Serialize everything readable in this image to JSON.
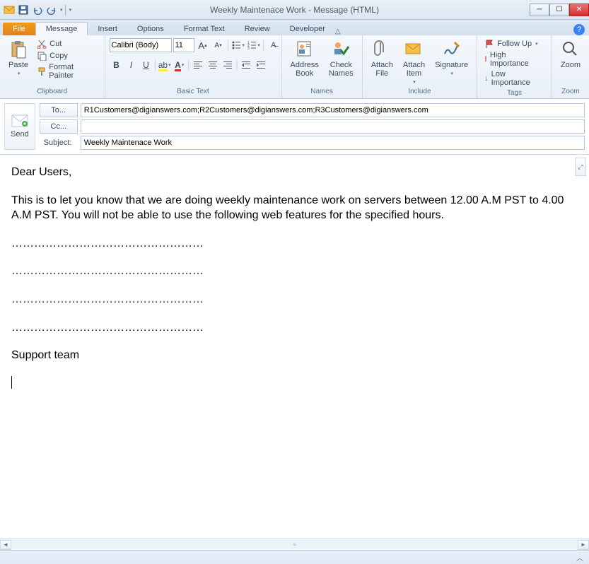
{
  "window": {
    "title": "Weekly Maintenace Work - Message (HTML)"
  },
  "tabs": {
    "file": "File",
    "items": [
      "Message",
      "Insert",
      "Options",
      "Format Text",
      "Review",
      "Developer"
    ],
    "active_index": 0
  },
  "ribbon": {
    "clipboard": {
      "label": "Clipboard",
      "paste": "Paste",
      "cut": "Cut",
      "copy": "Copy",
      "format_painter": "Format Painter"
    },
    "basic_text": {
      "label": "Basic Text",
      "font": "Calibri (Body)",
      "size": "11"
    },
    "names": {
      "label": "Names",
      "address_book": "Address Book",
      "check_names": "Check Names"
    },
    "include": {
      "label": "Include",
      "attach_file": "Attach File",
      "attach_item": "Attach Item",
      "signature": "Signature"
    },
    "tags": {
      "label": "Tags",
      "follow_up": "Follow Up",
      "high": "High Importance",
      "low": "Low Importance"
    },
    "zoom": {
      "label": "Zoom",
      "zoom": "Zoom"
    }
  },
  "address": {
    "send": "Send",
    "to_label": "To...",
    "cc_label": "Cc...",
    "subject_label": "Subject:",
    "to": "R1Customers@digianswers.com;R2Customers@digianswers.com;R3Customers@digianswers.com",
    "cc": "",
    "subject": "Weekly Maintenace Work"
  },
  "body": {
    "greeting": "Dear Users,",
    "para1": "This is to let you know that we are doing weekly maintenance work on servers between 12.00 A.M PST to 4.00 A.M PST. You will not be able to use the following web features for the specified hours.",
    "dots": "……………………………………………",
    "signoff": "Support team"
  }
}
